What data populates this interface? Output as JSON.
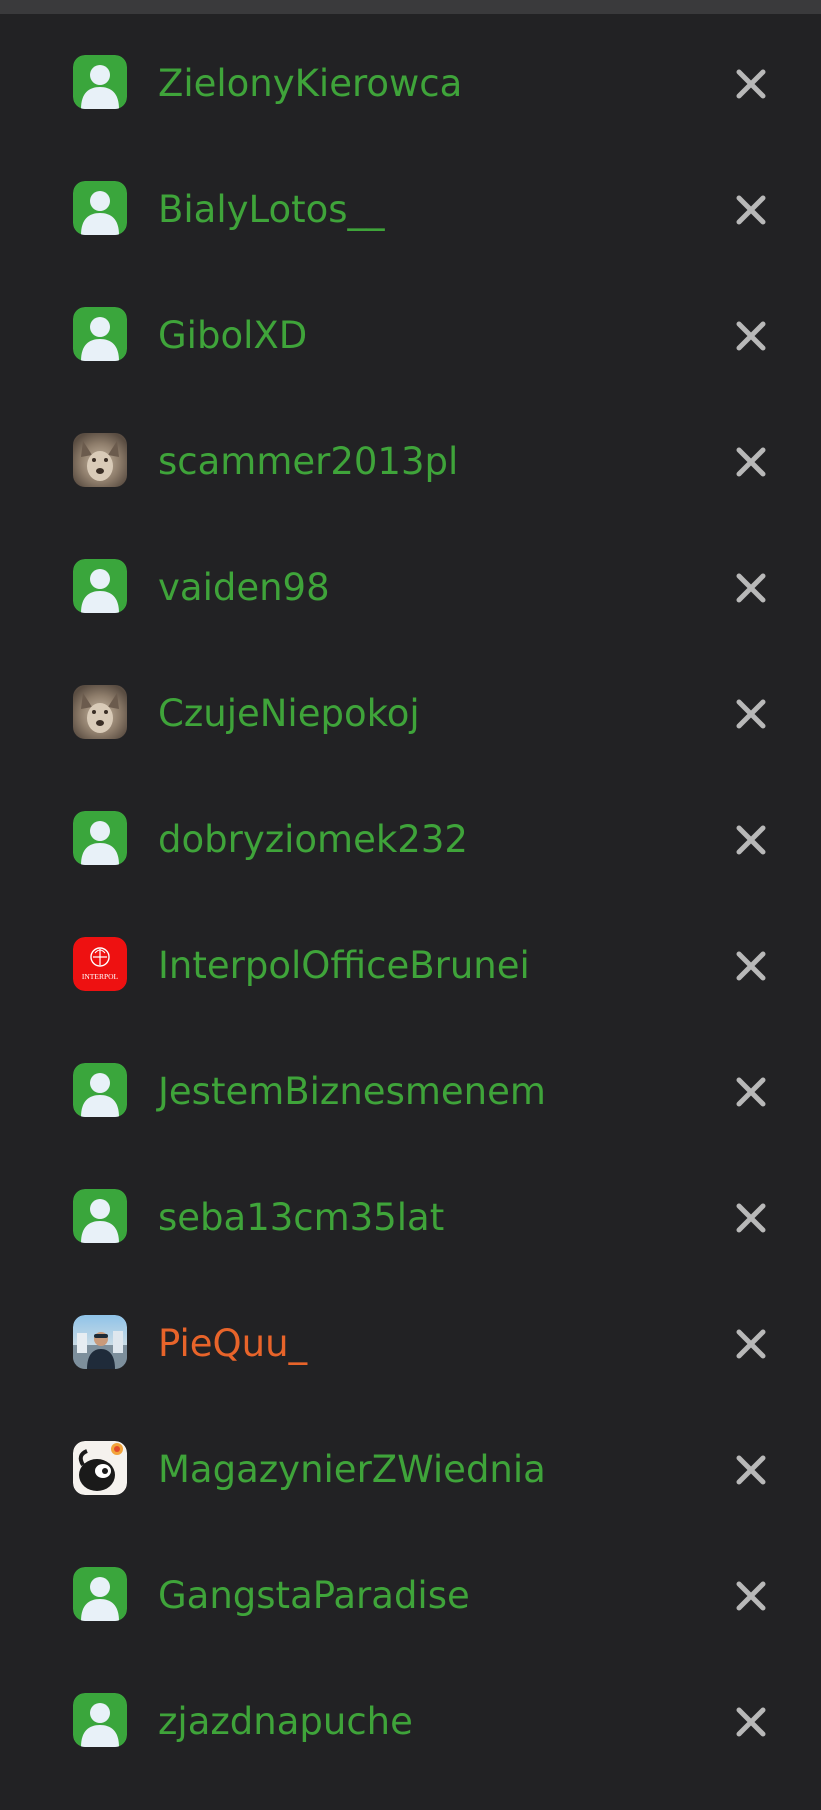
{
  "colors": {
    "background": "#222224",
    "username": "#3fa43a",
    "username_highlight": "#e8642a",
    "close_icon": "#b8b8b8",
    "default_avatar_bg": "#3aa63c"
  },
  "users": [
    {
      "name": "ZielonyKierowca",
      "avatar": "default-avatar-icon",
      "highlight": false
    },
    {
      "name": "BialyLotos__",
      "avatar": "default-avatar-icon",
      "highlight": false
    },
    {
      "name": "GibolXD",
      "avatar": "default-avatar-icon",
      "highlight": false
    },
    {
      "name": "scammer2013pl",
      "avatar": "wolf-photo-avatar",
      "highlight": false
    },
    {
      "name": "vaiden98",
      "avatar": "default-avatar-icon",
      "highlight": false
    },
    {
      "name": "CzujeNiepokoj",
      "avatar": "wolf-photo-avatar",
      "highlight": false
    },
    {
      "name": "dobryziomek232",
      "avatar": "default-avatar-icon",
      "highlight": false
    },
    {
      "name": "InterpolOfficeBrunei",
      "avatar": "interpol-logo-avatar",
      "avatar_text": "INTERPOL",
      "highlight": false
    },
    {
      "name": "JestemBiznesmenem",
      "avatar": "default-avatar-icon",
      "highlight": false
    },
    {
      "name": "seba13cm35lat",
      "avatar": "default-avatar-icon",
      "highlight": false
    },
    {
      "name": "PieQuu_",
      "avatar": "person-photo-avatar",
      "highlight": true
    },
    {
      "name": "MagazynierZWiednia",
      "avatar": "cartoon-photo-avatar",
      "highlight": false
    },
    {
      "name": "GangstaParadise",
      "avatar": "default-avatar-icon",
      "highlight": false
    },
    {
      "name": "zjazdnapuche",
      "avatar": "default-avatar-icon",
      "highlight": false
    }
  ],
  "remove_icon": "close-icon"
}
